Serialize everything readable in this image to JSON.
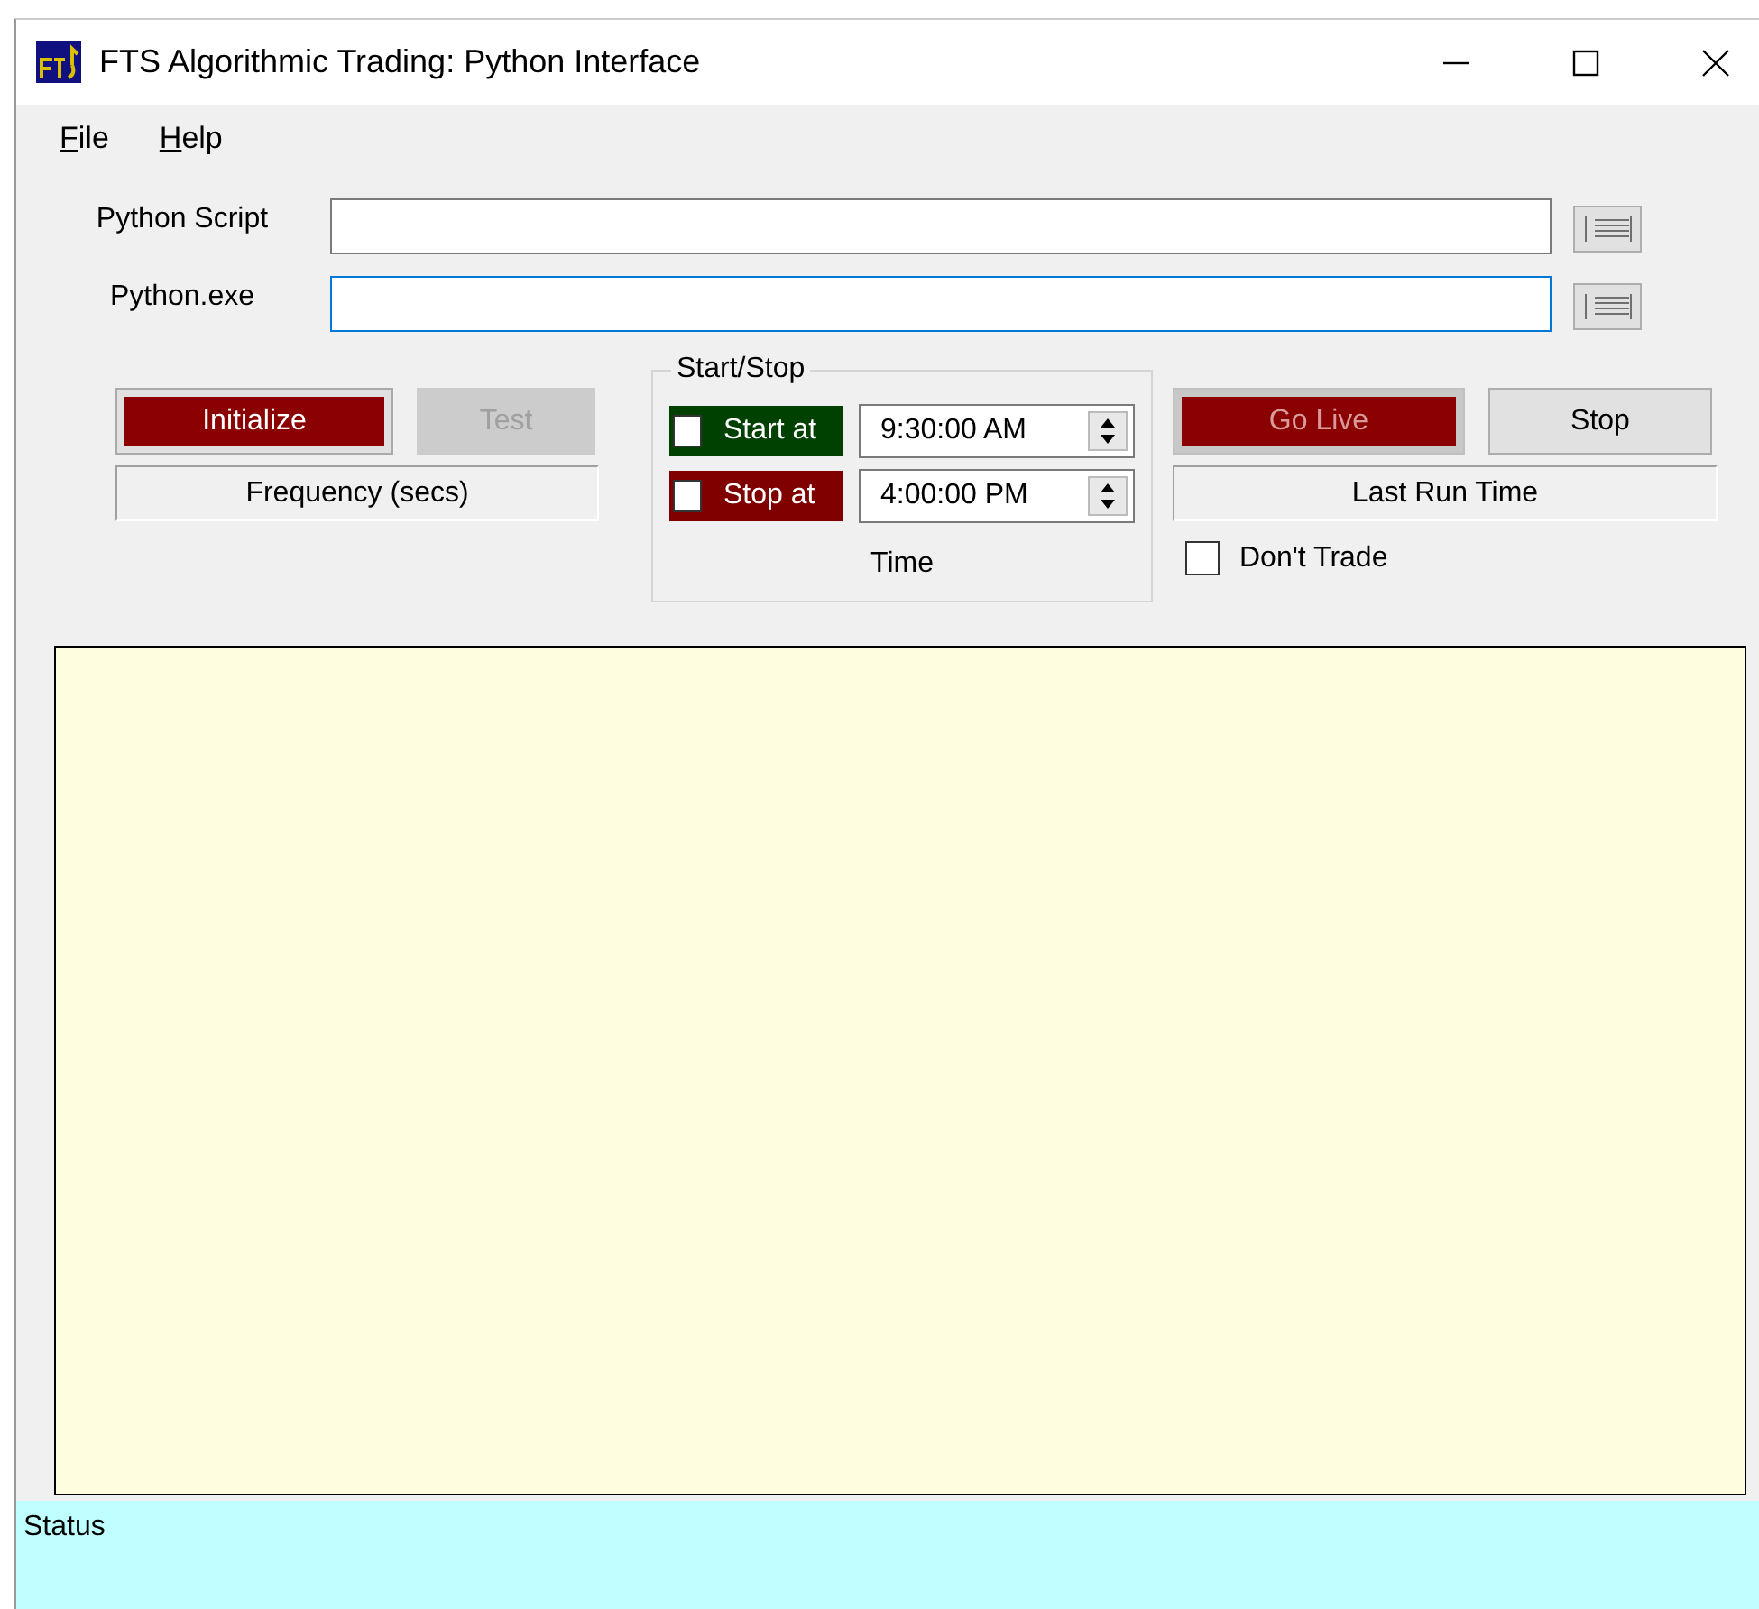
{
  "window": {
    "title": "FTS Algorithmic Trading: Python Interface"
  },
  "menu": [
    {
      "label": "File"
    },
    {
      "label": "Help"
    }
  ],
  "paths": [
    {
      "label": "Python Script",
      "focused": false
    },
    {
      "label": "Python.exe",
      "focused": true
    }
  ],
  "left_buttons": [
    {
      "label": "Initialize",
      "kind": "red",
      "disabled": false
    },
    {
      "label": "Test",
      "kind": "plain",
      "disabled": true
    }
  ],
  "frequency_label": "Frequency (secs)",
  "start_stop": {
    "title": "Start/Stop",
    "rows": [
      {
        "label": "Start at",
        "kind": "green",
        "checked": false,
        "time": "9:30:00 AM"
      },
      {
        "label": "Stop at",
        "kind": "red",
        "checked": false,
        "time": "4:00:00 PM"
      }
    ],
    "caption": "Time"
  },
  "right_buttons": [
    {
      "label": "Go Live",
      "kind": "red",
      "disabled": true
    },
    {
      "label": "Stop",
      "kind": "plain",
      "disabled": false
    }
  ],
  "last_run_label": "Last Run Time",
  "dont_trade": {
    "label": "Don't Trade",
    "checked": false
  },
  "status_bar": {
    "text": "Status"
  }
}
